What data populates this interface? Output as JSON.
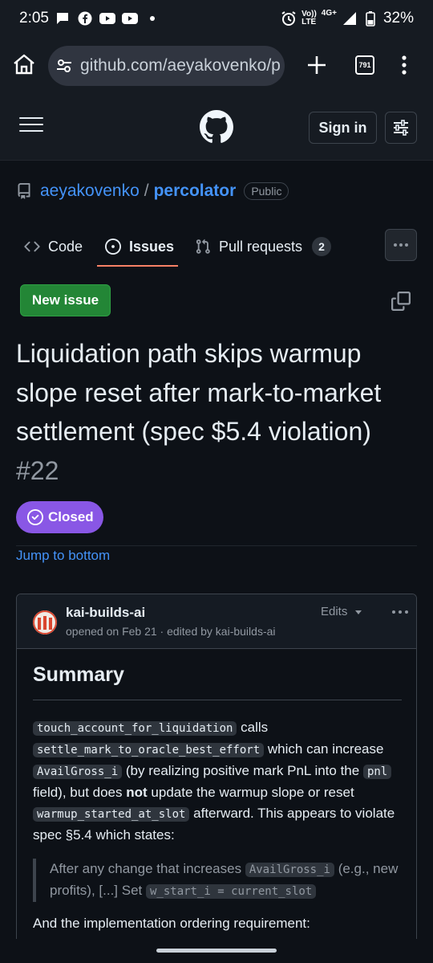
{
  "status_bar": {
    "time": "2:05",
    "network_label_top": "Vo))",
    "network_label_bottom": "LTE",
    "signal_label": "4G+",
    "battery": "32%"
  },
  "browser": {
    "url": "github.com/aeyakovenko/p",
    "tab_count": "791"
  },
  "header": {
    "sign_in_label": "Sign in"
  },
  "repo": {
    "owner": "aeyakovenko",
    "separator": "/",
    "name": "percolator",
    "visibility": "Public"
  },
  "tabs": [
    {
      "label": "Code"
    },
    {
      "label": "Issues"
    },
    {
      "label": "Pull requests",
      "count": "2"
    }
  ],
  "actions": {
    "new_issue_label": "New issue"
  },
  "issue": {
    "title": "Liquidation path skips warmup slope reset after mark-to-market settlement (spec $5.4 violation)",
    "number": "#22",
    "state": "Closed",
    "jump_label": "Jump to bottom"
  },
  "comment": {
    "author": "kai-builds-ai",
    "meta": "opened on Feb 21 · edited by kai-builds-ai",
    "edits_label": "Edits",
    "heading": "Summary",
    "para1": {
      "code1": "touch_account_for_liquidation",
      "t1": " calls ",
      "code2": "settle_mark_to_oracle_best_effort",
      "t2": " which can increase ",
      "code3": "AvailGross_i",
      "t3": " (by realizing positive mark PnL into the ",
      "code4": "pnl",
      "t4": " field), but does ",
      "bold": "not",
      "t5": " update the warmup slope or reset ",
      "code5": "warmup_started_at_slot",
      "t6": " afterward. This appears to violate spec §5.4 which states:"
    },
    "quote": {
      "t1": "After any change that increases ",
      "code1": "AvailGross_i",
      "t2": " (e.g., new profits), [...] Set ",
      "code2": "w_start_i = current_slot"
    },
    "para2": "And the implementation ordering requirement:"
  },
  "colors": {
    "accent_blue": "#4493f8",
    "new_issue_green": "#238636",
    "closed_purple": "#8957e5",
    "tab_underline": "#f78166"
  }
}
